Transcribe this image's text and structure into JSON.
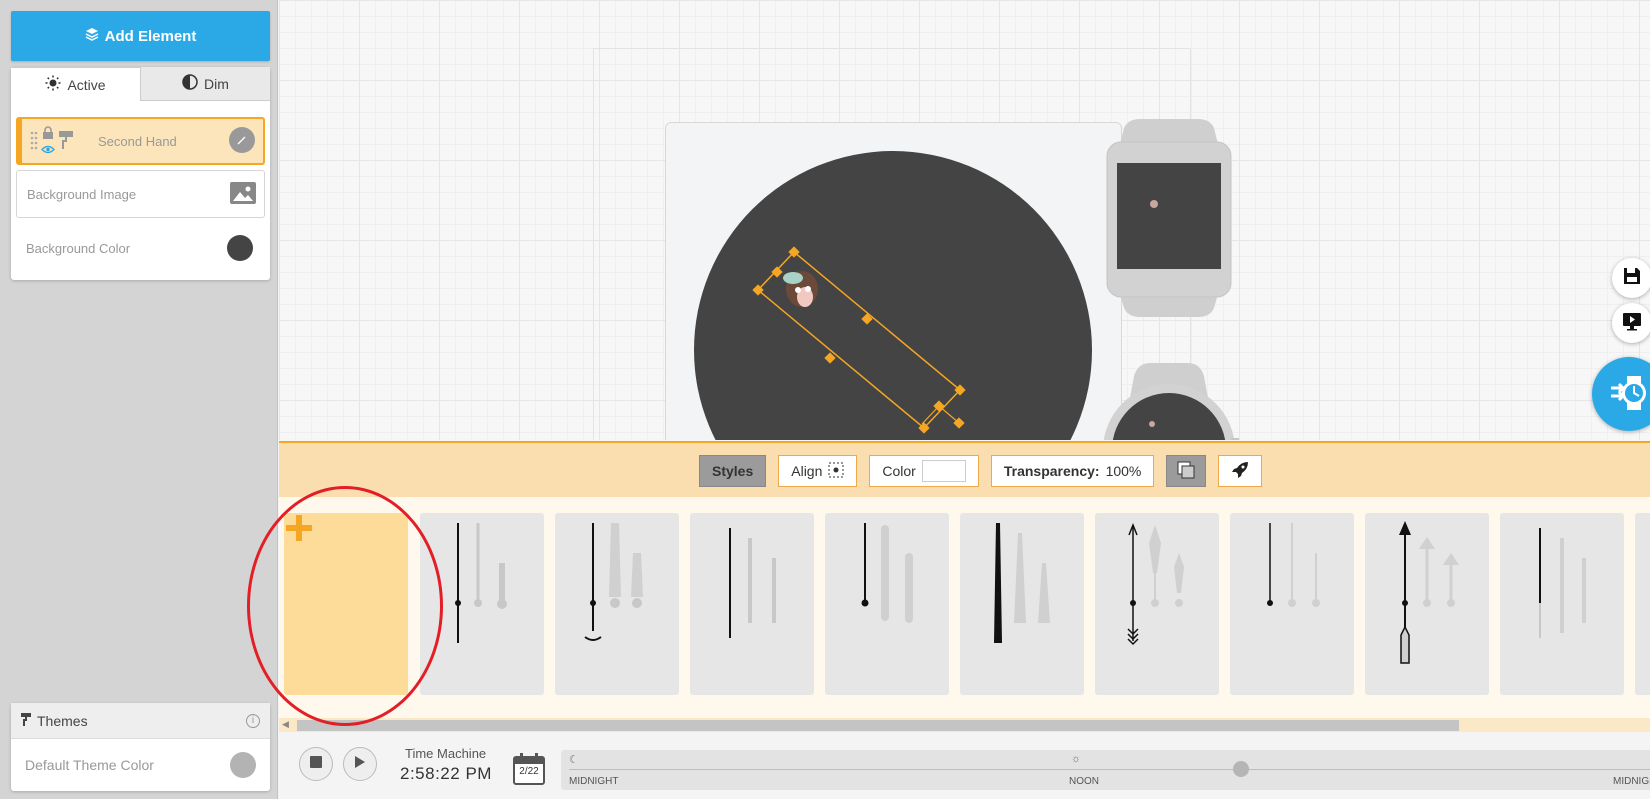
{
  "sidebar": {
    "add_element_label": "Add Element",
    "tabs": [
      {
        "label": "Active",
        "state": "selected"
      },
      {
        "label": "Dim",
        "state": "unselected"
      }
    ],
    "layers": [
      {
        "label": "Second Hand",
        "selected": true
      },
      {
        "label": "Background Image",
        "selected": false
      },
      {
        "label": "Background Color",
        "selected": false,
        "swatch": "#444444"
      }
    ],
    "themes": {
      "title": "Themes",
      "default_label": "Default Theme Color",
      "default_color": "#b3b3b3"
    }
  },
  "toolbar": {
    "styles_label": "Styles",
    "align_label": "Align",
    "color_label": "Color",
    "transparency_label": "Transparency:",
    "transparency_value": "100%"
  },
  "hand_picker": {
    "add_icon": "plus-icon",
    "styles": [
      "simple-round",
      "anchor-tail",
      "thin-line",
      "bead-tip",
      "tapered",
      "arrow-feather",
      "dot-pin",
      "arrow-long",
      "plain-thin"
    ]
  },
  "time_machine": {
    "label": "Time Machine",
    "time": "2:58:22 PM",
    "calendar_label": "2/22",
    "labels": {
      "midnight": "MIDNIGHT",
      "noon": "NOON",
      "midnight_end": "MIDNIGHT"
    },
    "day_fraction": 0.62
  },
  "colors": {
    "accent": "#2aa9e6",
    "selection": "#f5a623",
    "dial": "#444444",
    "annotation": "#e41e26"
  }
}
